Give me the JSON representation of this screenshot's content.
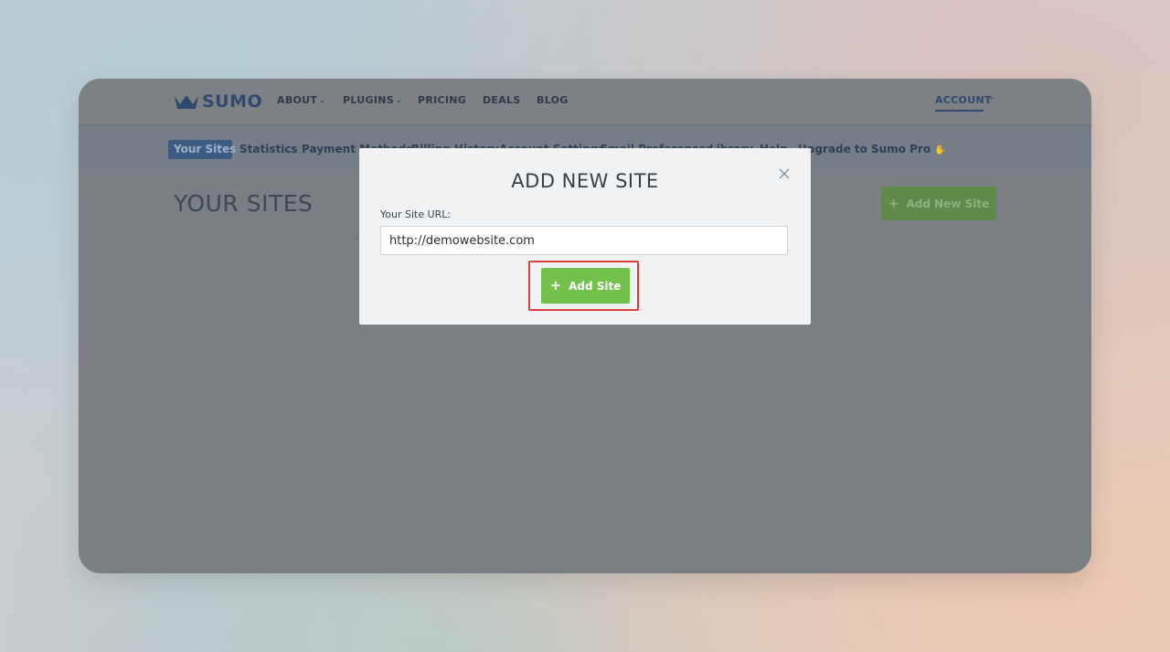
{
  "nav": {
    "logo_text": "SUMO",
    "items": [
      {
        "label": "ABOUT",
        "has_dropdown": true
      },
      {
        "label": "PLUGINS",
        "has_dropdown": true
      },
      {
        "label": "PRICING",
        "has_dropdown": false
      },
      {
        "label": "DEALS",
        "has_dropdown": false
      },
      {
        "label": "BLOG",
        "has_dropdown": false
      }
    ],
    "account_label": "ACCOUNT"
  },
  "subnav": {
    "items": [
      {
        "label": "Your Sites",
        "active": true
      },
      {
        "label": "Statistics"
      },
      {
        "label": "Payment Methods"
      },
      {
        "label": "Billing History"
      },
      {
        "label": "Account Settings"
      },
      {
        "label": "Email Preferences"
      },
      {
        "label": "Library"
      },
      {
        "label": "Help"
      },
      {
        "label": "Upgrade to Sumo Pro"
      }
    ]
  },
  "main": {
    "title": "YOUR SITES",
    "add_new_site_label": "Add New Site"
  },
  "modal": {
    "title": "ADD NEW SITE",
    "url_label": "Your Site URL:",
    "url_value": "http://demowebsite.com",
    "submit_label": "Add Site"
  },
  "colors": {
    "brand": "#2f4a6e",
    "submit_green": "#73c14a",
    "highlight_red": "#d94040"
  }
}
